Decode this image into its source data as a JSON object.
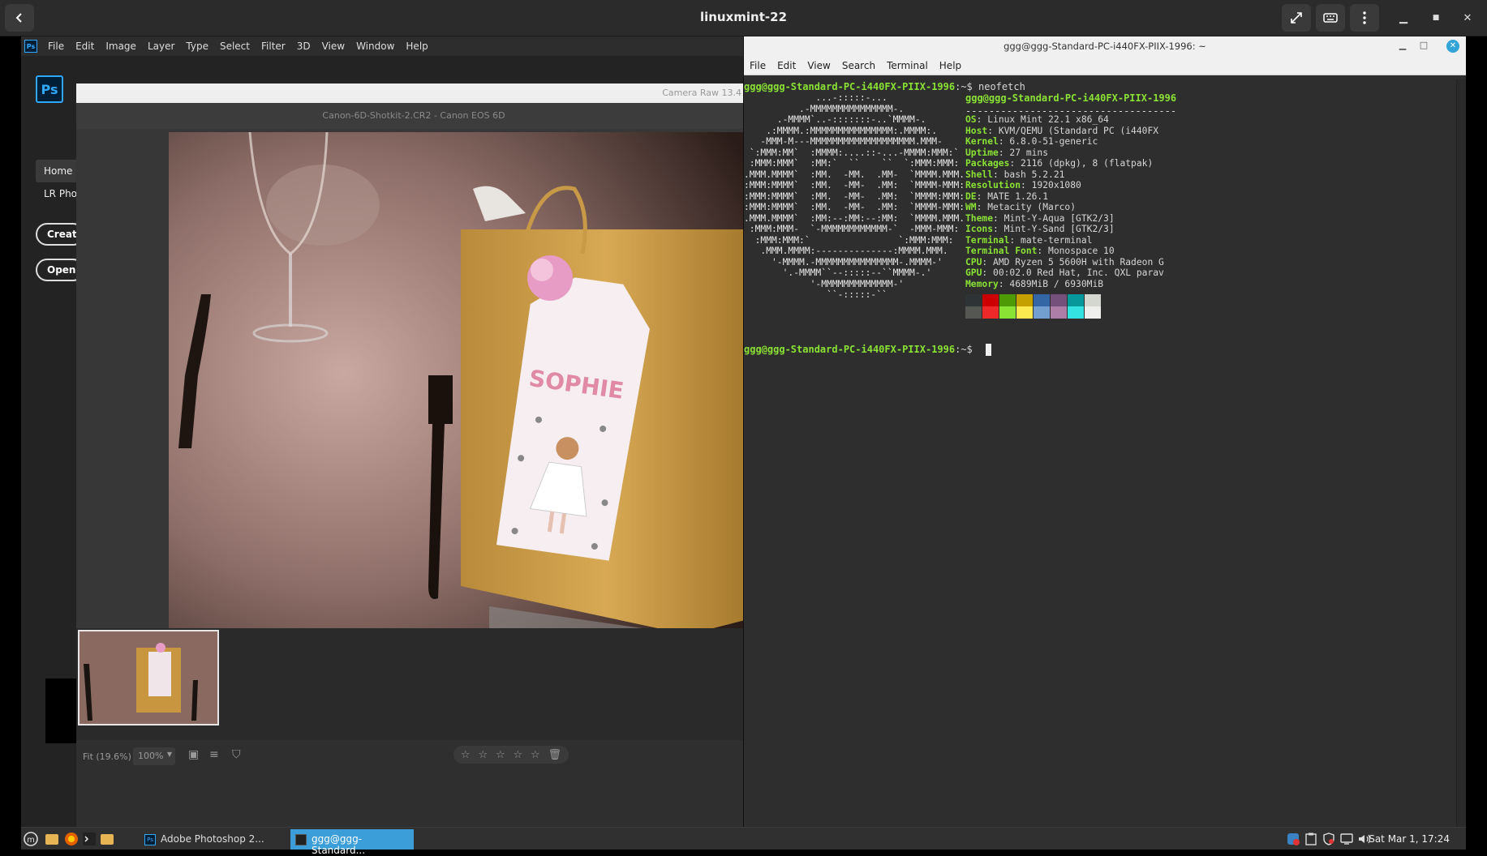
{
  "host": {
    "title": "linuxmint-22"
  },
  "photoshop": {
    "menu": [
      "File",
      "Edit",
      "Image",
      "Layer",
      "Type",
      "Select",
      "Filter",
      "3D",
      "View",
      "Window",
      "Help"
    ],
    "logo": "Ps",
    "nav": [
      "Home",
      "LR Pho"
    ],
    "buttons": [
      "Create",
      "Open."
    ]
  },
  "camera_raw": {
    "title": "Camera Raw 13.4",
    "file_info": "Canon-6D-Shotkit-2.CR2  -  Canon EOS 6D",
    "tag_text": "SOPHIE",
    "fit_label": "Fit (19.6%)",
    "zoom_value": "100%",
    "rating_stars": 5
  },
  "terminal": {
    "title": "ggg@ggg-Standard-PC-i440FX-PIIX-1996: ~",
    "menu": [
      "File",
      "Edit",
      "View",
      "Search",
      "Terminal",
      "Help"
    ],
    "prompt": "ggg@ggg-Standard-PC-i440FX-PIIX-1996",
    "prompt_suffix": ":~$ ",
    "command": "neofetch",
    "ascii": [
      "             ...-:::::-...",
      "          .-MMMMMMMMMMMMMMM-.",
      "      .-MMMM`..-:::::::-..`MMMM-.",
      "    .:MMMM.:MMMMMMMMMMMMMMM:.MMMM:.",
      "   -MMM-M---MMMMMMMMMMMMMMMMMMM.MMM-",
      " `:MMM:MM`  :MMMM:....::-...-MMMM:MMM:`",
      " :MMM:MMM`  :MM:`  ``    ``  `:MMM:MMM:",
      ".MMM.MMMM`  :MM.  -MM.  .MM-  `MMMM.MMM.",
      ":MMM:MMMM`  :MM.  -MM-  .MM:  `MMMM-MMM:",
      ":MMM:MMMM`  :MM.  -MM-  .MM:  `MMMM:MMM:",
      ":MMM:MMMM`  :MM.  -MM-  .MM:  `MMMM-MMM:",
      ".MMM.MMMM`  :MM:--:MM:--:MM:  `MMMM.MMM.",
      " :MMM:MMM-  `-MMMMMMMMMMMM-`  -MMM-MMM:",
      "  :MMM:MMM:`                `:MMM:MMM:",
      "   .MMM.MMMM:--------------:MMMM.MMM.",
      "     '-MMMM.-MMMMMMMMMMMMMMM-.MMMM-'",
      "       '.-MMMM``--:::::--``MMMM-.'",
      "            '-MMMMMMMMMMMMM-'",
      "               ``-:::::-``"
    ],
    "user_host": "ggg@ggg-Standard-PC-i440FX-PIIX-1996",
    "separator": "------------------------------------",
    "info": [
      {
        "label": "OS",
        "value": "Linux Mint 22.1 x86_64"
      },
      {
        "label": "Host",
        "value": "KVM/QEMU (Standard PC (i440FX"
      },
      {
        "label": "Kernel",
        "value": "6.8.0-51-generic"
      },
      {
        "label": "Uptime",
        "value": "27 mins"
      },
      {
        "label": "Packages",
        "value": "2116 (dpkg), 8 (flatpak)"
      },
      {
        "label": "Shell",
        "value": "bash 5.2.21"
      },
      {
        "label": "Resolution",
        "value": "1920x1080"
      },
      {
        "label": "DE",
        "value": "MATE 1.26.1"
      },
      {
        "label": "WM",
        "value": "Metacity (Marco)"
      },
      {
        "label": "Theme",
        "value": "Mint-Y-Aqua [GTK2/3]"
      },
      {
        "label": "Icons",
        "value": "Mint-Y-Sand [GTK2/3]"
      },
      {
        "label": "Terminal",
        "value": "mate-terminal"
      },
      {
        "label": "Terminal Font",
        "value": "Monospace 10"
      },
      {
        "label": "CPU",
        "value": "AMD Ryzen 5 5600H with Radeon G"
      },
      {
        "label": "GPU",
        "value": "00:02.0 Red Hat, Inc. QXL parav"
      },
      {
        "label": "Memory",
        "value": "4689MiB / 6930MiB"
      }
    ],
    "palette_top": [
      "#2e3436",
      "#cc0000",
      "#4e9a06",
      "#c4a000",
      "#3465a4",
      "#75507b",
      "#06989a",
      "#d3d7cf"
    ],
    "palette_bottom": [
      "#555753",
      "#ef2929",
      "#8ae234",
      "#fce94f",
      "#729fcf",
      "#ad7fa8",
      "#34e2e2",
      "#eeeeec"
    ]
  },
  "taskbar": {
    "windows": [
      "Adobe Photoshop 2...",
      "ggg@ggg-Standard..."
    ],
    "clock": "Sat Mar  1, 17:24"
  }
}
